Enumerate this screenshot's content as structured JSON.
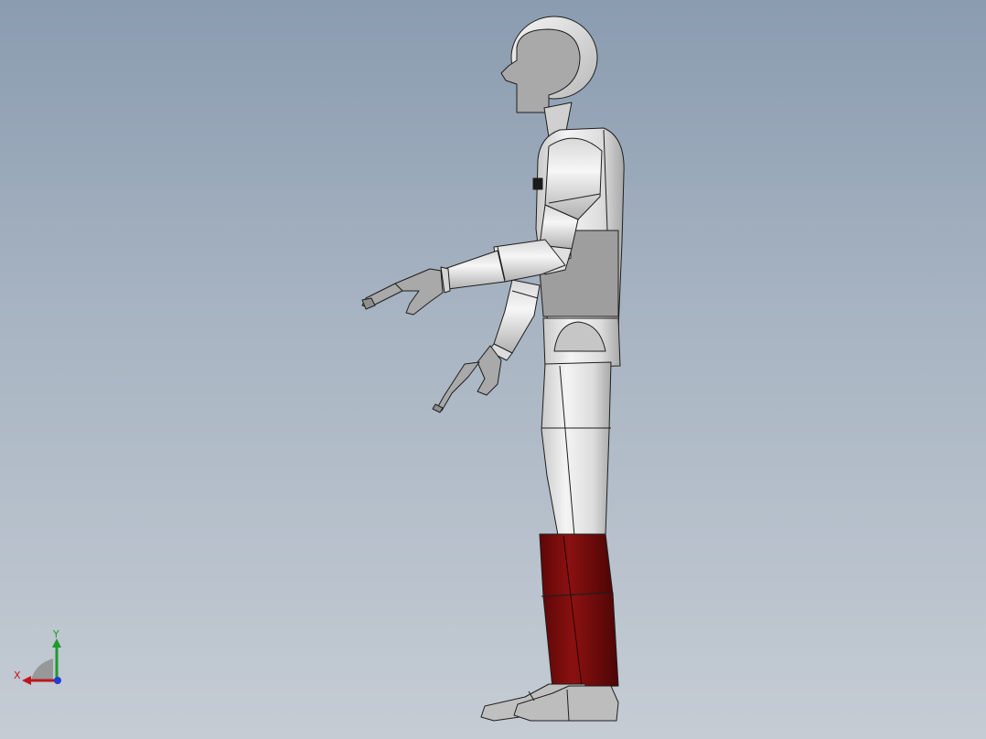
{
  "viewport": {
    "background_top": "#8a9cb0",
    "background_bottom": "#c5ccd4"
  },
  "model": {
    "part_name": "humanoid-model",
    "colors": {
      "body": "#e2e2e2",
      "body_shadow": "#b8b8b8",
      "head_face": "#a9a9a9",
      "torso_panel": "#9e9e9e",
      "lower_leg": "#7a0c0c",
      "foot": "#bdbdbd",
      "edge": "#1e1e1e"
    }
  },
  "triad": {
    "x_label": "X",
    "y_label": "Y",
    "x_color": "#c0151c",
    "y_color": "#1e9a2c",
    "z_color": "#1f3fd0"
  }
}
